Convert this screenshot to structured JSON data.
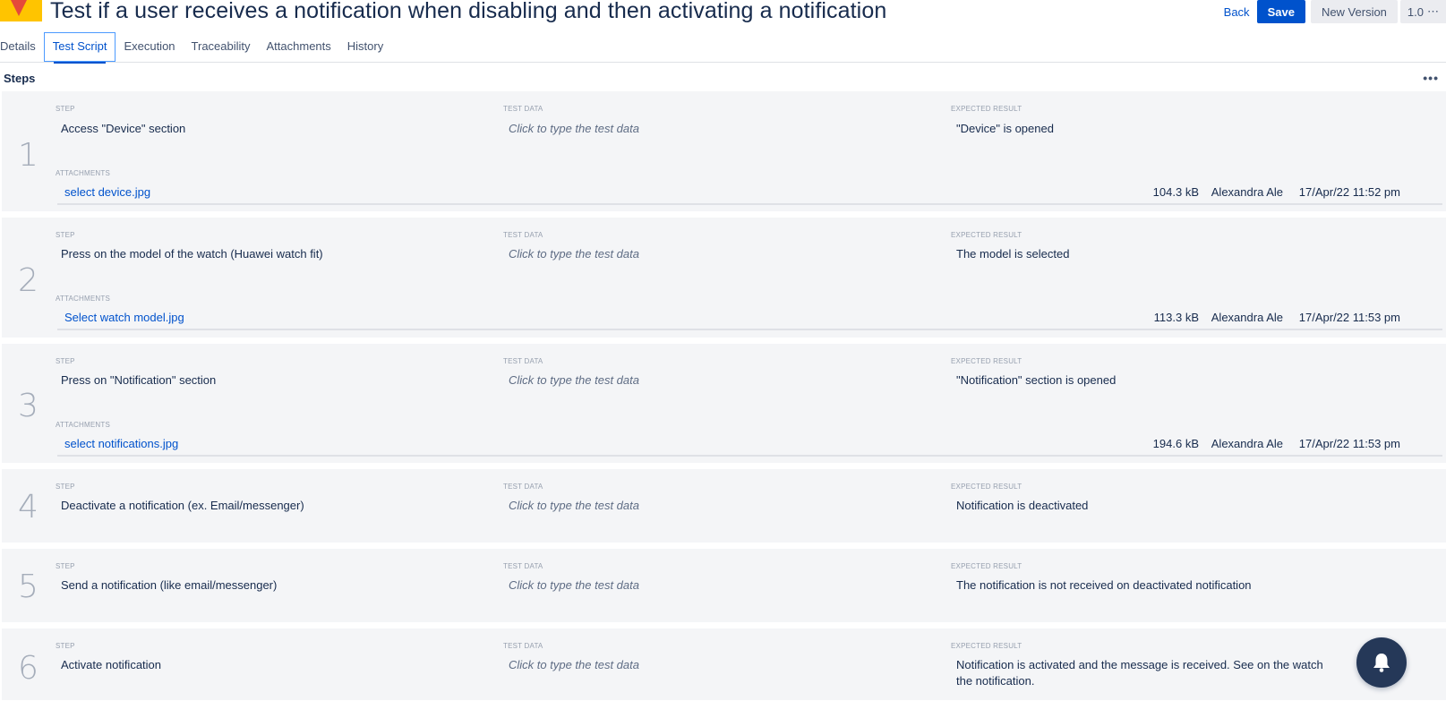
{
  "header": {
    "title": "Test if a user receives a notification when disabling and then activating a notification",
    "back_label": "Back",
    "save_label": "Save",
    "new_version_label": "New Version",
    "version_label": "1.0"
  },
  "tabs": [
    {
      "label": "Details"
    },
    {
      "label": "Test Script",
      "active": true
    },
    {
      "label": "Execution"
    },
    {
      "label": "Traceability"
    },
    {
      "label": "Attachments"
    },
    {
      "label": "History"
    }
  ],
  "steps_heading": "Steps",
  "labels": {
    "step": "STEP",
    "test_data": "TEST DATA",
    "expected_result": "EXPECTED RESULT",
    "attachments": "ATTACHMENTS"
  },
  "steps": [
    {
      "number": "1",
      "step": "Access \"Device\" section",
      "test_data": "Click to type the test data",
      "expected": "\"Device\" is opened",
      "attachment": {
        "name": "select device.jpg",
        "size": "104.3 kB",
        "user": "Alexandra Ale",
        "date": "17/Apr/22 11:52 pm"
      }
    },
    {
      "number": "2",
      "step": "Press on the model of the watch (Huawei watch fit)",
      "test_data": "Click to type the test data",
      "expected": "The model is selected",
      "attachment": {
        "name": "Select watch model.jpg",
        "size": "113.3 kB",
        "user": "Alexandra Ale",
        "date": "17/Apr/22 11:53 pm"
      }
    },
    {
      "number": "3",
      "step": "Press on \"Notification\" section",
      "test_data": "Click to type the test data",
      "expected": "\"Notification\" section is opened",
      "attachment": {
        "name": "select notifications.jpg",
        "size": "194.6 kB",
        "user": "Alexandra Ale",
        "date": "17/Apr/22 11:53 pm"
      }
    },
    {
      "number": "4",
      "step": "Deactivate a notification (ex. Email/messenger)",
      "test_data": "Click to type the test data",
      "expected": "Notification is deactivated"
    },
    {
      "number": "5",
      "step": "Send a notification (like email/messenger)",
      "test_data": "Click to type the test data",
      "expected": "The notification is not received on deactivated notification"
    },
    {
      "number": "6",
      "step": "Activate notification",
      "test_data": "Click to type the test data",
      "expected": "Notification is activated and the message is received. See on the watch the notification."
    }
  ],
  "icons": {
    "more": "more-horizontal-icon",
    "notifications": "bell-icon",
    "version_menu": "more-horizontal-icon"
  },
  "colors": {
    "primary": "#0052cc",
    "step_bg": "#f4f5f7",
    "bell_bg": "#253858",
    "logo_yellow": "#ffc400",
    "logo_red": "#e5493a"
  }
}
